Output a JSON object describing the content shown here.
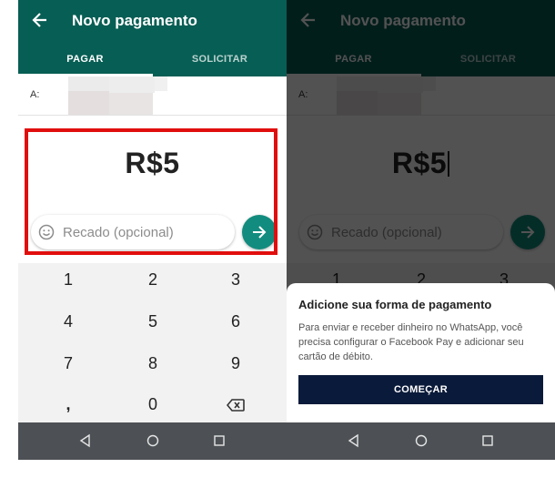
{
  "appbar": {
    "title": "Novo pagamento",
    "back_icon": "arrow-left-icon"
  },
  "tabs": [
    {
      "label": "PAGAR",
      "selected": true
    },
    {
      "label": "SOLICITAR",
      "selected": false
    }
  ],
  "recipient": {
    "label": "A:"
  },
  "amount": {
    "value": "R$5"
  },
  "note": {
    "placeholder": "Recado (opcional)",
    "emoji_icon": "smiley-icon"
  },
  "send": {
    "icon": "arrow-right-icon"
  },
  "keypad": {
    "rows": [
      [
        "1",
        "2",
        "3"
      ],
      [
        "4",
        "5",
        "6"
      ],
      [
        "7",
        "8",
        "9"
      ],
      [
        ",",
        "0",
        "backspace"
      ]
    ]
  },
  "sheet": {
    "title": "Adicione sua forma de pagamento",
    "body": "Para enviar e receber dinheiro no WhatsApp, você precisa configurar o Facebook Pay e adicionar seu cartão de débito.",
    "button": "COMEÇAR"
  },
  "nav": {
    "back": "triangle-back-icon",
    "home": "circle-home-icon",
    "recents": "square-recents-icon"
  },
  "colors": {
    "appbar": "#075e54",
    "send": "#128c7e",
    "highlight": "#e10e0e",
    "button": "#0a1a3a"
  }
}
